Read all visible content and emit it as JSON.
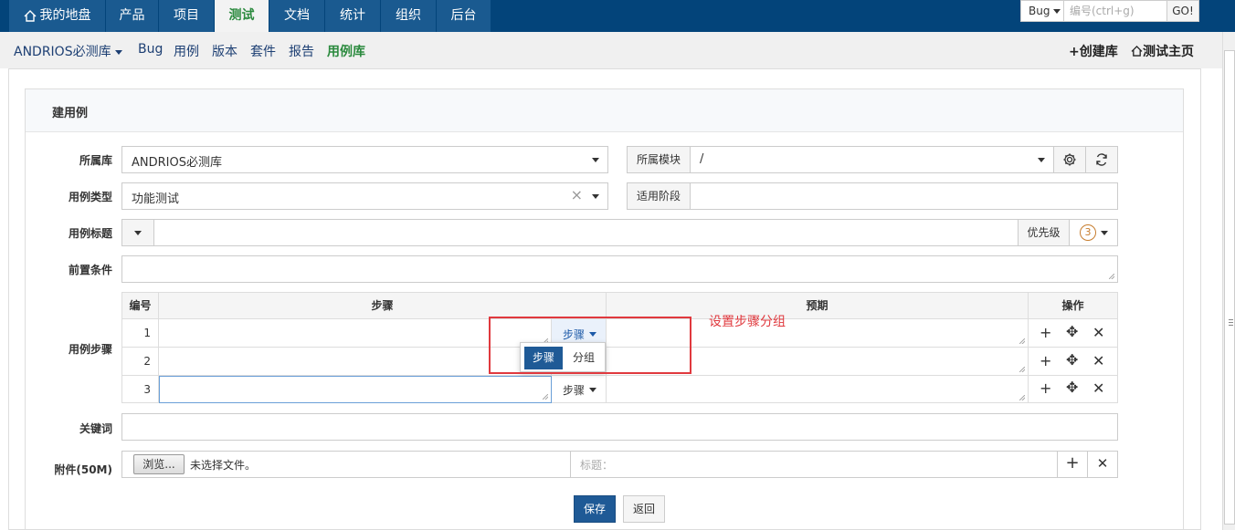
{
  "topnav": {
    "items": [
      "我的地盘",
      "产品",
      "项目",
      "测试",
      "文档",
      "统计",
      "组织",
      "后台"
    ],
    "active": "测试",
    "search_type": "Bug",
    "search_placeholder": "编号(ctrl+g)",
    "go_label": "GO!"
  },
  "subnav": {
    "library": "ANDRIOS必测库",
    "items": [
      "Bug",
      "用例",
      "版本",
      "套件",
      "报告",
      "用例库"
    ],
    "active": "用例库",
    "create_lib": "创建库",
    "test_home": "测试主页"
  },
  "form": {
    "title": "建用例",
    "lib_label": "所属库",
    "lib_value": "ANDRIOS必测库",
    "module_label": "所属模块",
    "module_value": "/",
    "type_label": "用例类型",
    "type_value": "功能测试",
    "stage_label": "适用阶段",
    "title_label": "用例标题",
    "priority_label": "优先级",
    "priority_value": "3",
    "precondition_label": "前置条件",
    "steps_label": "用例步骤",
    "steps_headers": {
      "num": "编号",
      "step": "步骤",
      "expect": "预期",
      "ops": "操作"
    },
    "rows": [
      {
        "num": "1",
        "type": "步骤"
      },
      {
        "num": "2",
        "type": "步骤"
      },
      {
        "num": "3",
        "type": "步骤"
      }
    ],
    "dropdown_options": [
      "步骤",
      "分组"
    ],
    "annotation": "设置步骤分组",
    "keywords_label": "关键词",
    "attach_label": "附件(50M)",
    "browse_label": "浏览...",
    "no_file": "未选择文件。",
    "attach_title_placeholder": "标题：",
    "save_label": "保存",
    "back_label": "返回"
  },
  "colors": {
    "nav_bg": "#03447a",
    "active_green": "#2b8a3e",
    "annotation_red": "#e0393e",
    "primary_btn": "#1f5a96"
  }
}
